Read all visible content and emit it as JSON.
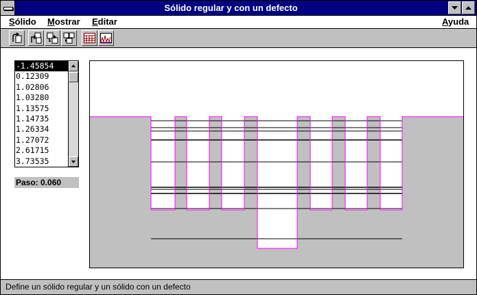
{
  "window": {
    "title": "Sólido regular y con un defecto"
  },
  "menu": {
    "solido_pre": "",
    "solido_key": "S",
    "solido_rest": "ólido",
    "mostrar_key": "M",
    "mostrar_rest": "ostrar",
    "editar_key": "E",
    "editar_rest": "ditar",
    "ayuda_key": "A",
    "ayuda_rest": "yuda"
  },
  "toolbar": {
    "icons": [
      "rotate-icon",
      "copy-left-icon",
      "copy-right-icon",
      "copy-both-icon",
      "table-icon",
      "plot-icon"
    ]
  },
  "list": {
    "items": [
      "-1.45854",
      "0.12309",
      "1.02806",
      "1.03280",
      "1.13575",
      "1.14735",
      "1.26334",
      "1.27072",
      "2.61715",
      "3.73535"
    ],
    "selected_index": 0
  },
  "paso": {
    "label": "Paso: 0.060"
  },
  "plot": {
    "colors": {
      "fill": "#c0c0c0",
      "outline": "#ff00ff",
      "lines": "#000000"
    }
  },
  "status": {
    "text": "Define un sólido regular y un sólido con un defecto"
  }
}
